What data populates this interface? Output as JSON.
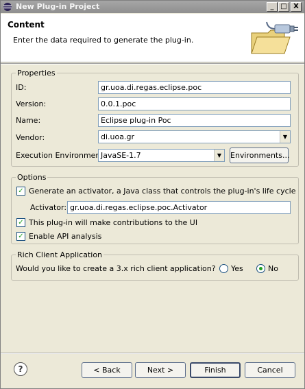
{
  "window": {
    "title": "New Plug-in Project",
    "controls": {
      "minimize": "_",
      "maximize": "□",
      "close": "X"
    }
  },
  "header": {
    "title": "Content",
    "description": "Enter the data required to generate the plug-in.",
    "icon": "plugin-folder-icon"
  },
  "properties": {
    "legend": "Properties",
    "id_label": "ID:",
    "id_value": "gr.uoa.di.regas.eclipse.poc",
    "version_label": "Version:",
    "version_value": "0.0.1.poc",
    "name_label": "Name:",
    "name_value": "Eclipse plug-in Poc",
    "vendor_label": "Vendor:",
    "vendor_value": "di.uoa.gr",
    "ee_label": "Execution Environment:",
    "ee_value": "JavaSE-1.7",
    "environments_button": "Environments..."
  },
  "options": {
    "legend": "Options",
    "generate_activator_label": "Generate an activator, a Java class that controls the plug-in's life cycle",
    "generate_activator_checked": true,
    "activator_label": "Activator:",
    "activator_value": "gr.uoa.di.regas.eclipse.poc.Activator",
    "ui_contrib_label": "This plug-in will make contributions to the UI",
    "ui_contrib_checked": true,
    "api_analysis_label": "Enable API analysis",
    "api_analysis_checked": true
  },
  "rcp": {
    "legend": "Rich Client Application",
    "question": "Would you like to create a 3.x rich client application?",
    "yes_label": "Yes",
    "no_label": "No",
    "selected": "No"
  },
  "footer": {
    "help_icon": "help-icon",
    "back_button": "< Back",
    "next_button": "Next >",
    "finish_button": "Finish",
    "cancel_button": "Cancel"
  },
  "colors": {
    "title_bar": "#999999",
    "header_bg": "#ffffff",
    "dialog_bg": "#ece9d8",
    "check_mark": "#21a121"
  }
}
